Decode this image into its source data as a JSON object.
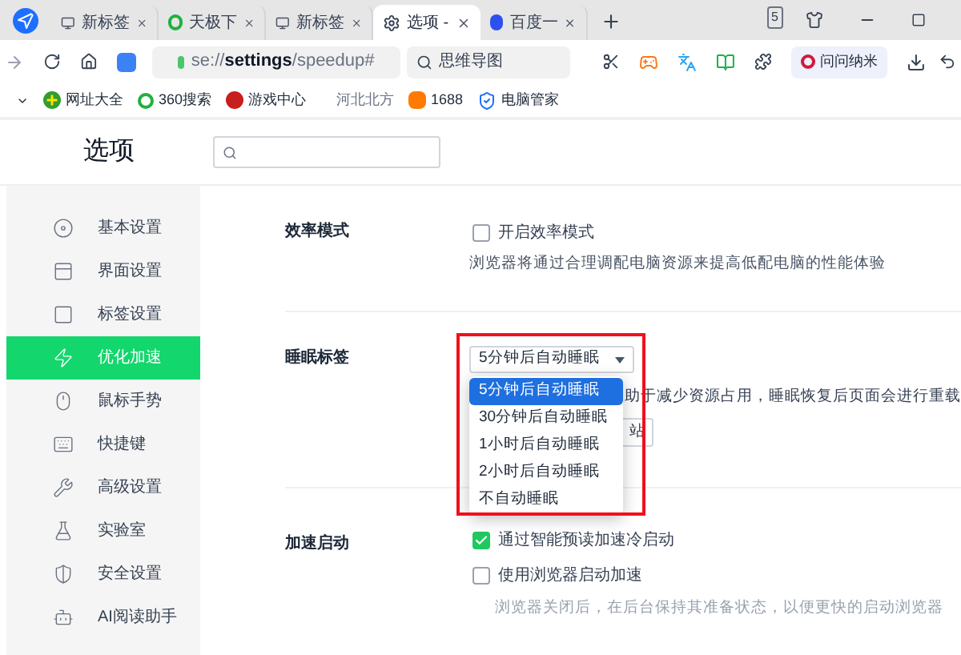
{
  "tabs": [
    {
      "title": "新标签",
      "selected": false
    },
    {
      "title": "天极下",
      "selected": false
    },
    {
      "title": "新标签",
      "selected": false
    },
    {
      "title": "选项 - ",
      "selected": true
    },
    {
      "title": "百度一",
      "selected": false
    }
  ],
  "tab_count": "5",
  "address": "se://**settings**/speedup#",
  "search": {
    "value": "思维导图"
  },
  "profile": "问问纳米",
  "bookmarks": [
    "网址大全",
    "360搜索",
    "游戏中心",
    "河北北方",
    "1688",
    "电脑管家"
  ],
  "page_title": "选项",
  "sidebar": {
    "items": [
      {
        "label": "基本设置",
        "selected": false
      },
      {
        "label": "界面设置",
        "selected": false
      },
      {
        "label": "标签设置",
        "selected": false
      },
      {
        "label": "优化加速",
        "selected": true
      },
      {
        "label": "鼠标手势",
        "selected": false
      },
      {
        "label": "快捷键",
        "selected": false
      },
      {
        "label": "高级设置",
        "selected": false
      },
      {
        "label": "实验室",
        "selected": false
      },
      {
        "label": "安全设置",
        "selected": false
      },
      {
        "label": "AI阅读助手",
        "selected": false
      }
    ]
  },
  "sections": [
    {
      "title": "效率模式",
      "options": [
        {
          "label": "开启效率模式",
          "checked": false
        }
      ],
      "description": "浏览器将通过合理调配电脑资源来提高低配电脑的性能体验"
    },
    {
      "title": "睡眠标签",
      "select": {
        "value": "5分钟后自动睡眠",
        "options": [
          {
            "label": "5分钟后自动睡眠",
            "selected": true
          },
          {
            "label": "30分钟后自动睡眠",
            "selected": false
          },
          {
            "label": "1小时后自动睡眠",
            "selected": false
          },
          {
            "label": "2小时后自动睡眠",
            "selected": false
          },
          {
            "label": "不自动睡眠",
            "selected": false
          }
        ]
      },
      "description": "助于减少资源占用，睡眠恢复后页面会进行重载",
      "button": "站"
    },
    {
      "title": "加速启动",
      "options": [
        {
          "label": "通过智能预读加速冷启动",
          "checked": true
        },
        {
          "label": "使用浏览器启动加速",
          "checked": false
        }
      ],
      "description": "浏览器关闭后，在后台保持其准备状态，以便更快的启动浏览器"
    }
  ]
}
